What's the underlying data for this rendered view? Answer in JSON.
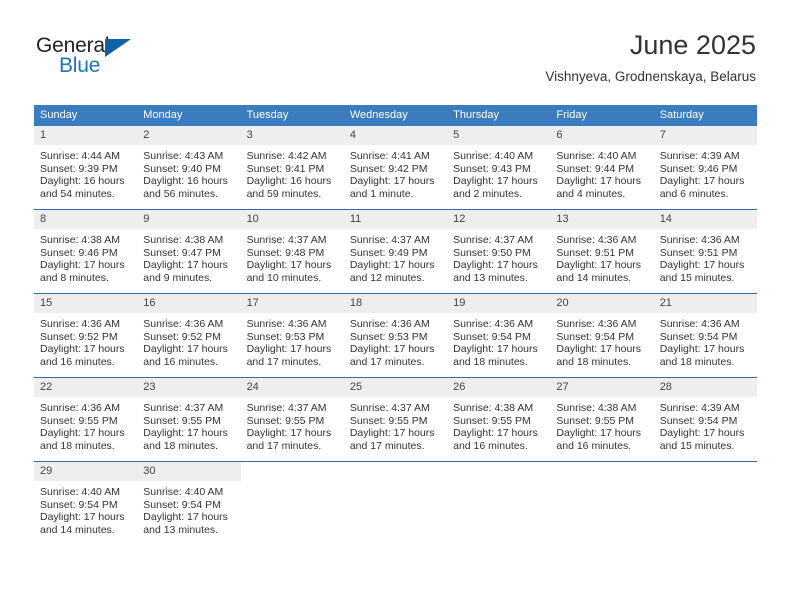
{
  "brand": {
    "name_top": "General",
    "name_bottom": "Blue",
    "triangle_color": "#1161a6",
    "blue_color": "#1b76bc"
  },
  "header": {
    "title": "June 2025",
    "subtitle": "Vishnyeva, Grodnenskaya, Belarus"
  },
  "theme": {
    "header_bg": "#3b7cbf",
    "row_divider": "#2e6da4",
    "daynum_bg": "#eeeeee"
  },
  "weekdays": [
    "Sunday",
    "Monday",
    "Tuesday",
    "Wednesday",
    "Thursday",
    "Friday",
    "Saturday"
  ],
  "labels": {
    "sunrise_prefix": "Sunrise:",
    "sunset_prefix": "Sunset:",
    "daylight_prefix": "Daylight:"
  },
  "weeks": [
    [
      {
        "day": "1",
        "sunrise": "Sunrise: 4:44 AM",
        "sunset": "Sunset: 9:39 PM",
        "daylight": "Daylight: 16 hours and 54 minutes."
      },
      {
        "day": "2",
        "sunrise": "Sunrise: 4:43 AM",
        "sunset": "Sunset: 9:40 PM",
        "daylight": "Daylight: 16 hours and 56 minutes."
      },
      {
        "day": "3",
        "sunrise": "Sunrise: 4:42 AM",
        "sunset": "Sunset: 9:41 PM",
        "daylight": "Daylight: 16 hours and 59 minutes."
      },
      {
        "day": "4",
        "sunrise": "Sunrise: 4:41 AM",
        "sunset": "Sunset: 9:42 PM",
        "daylight": "Daylight: 17 hours and 1 minute."
      },
      {
        "day": "5",
        "sunrise": "Sunrise: 4:40 AM",
        "sunset": "Sunset: 9:43 PM",
        "daylight": "Daylight: 17 hours and 2 minutes."
      },
      {
        "day": "6",
        "sunrise": "Sunrise: 4:40 AM",
        "sunset": "Sunset: 9:44 PM",
        "daylight": "Daylight: 17 hours and 4 minutes."
      },
      {
        "day": "7",
        "sunrise": "Sunrise: 4:39 AM",
        "sunset": "Sunset: 9:46 PM",
        "daylight": "Daylight: 17 hours and 6 minutes."
      }
    ],
    [
      {
        "day": "8",
        "sunrise": "Sunrise: 4:38 AM",
        "sunset": "Sunset: 9:46 PM",
        "daylight": "Daylight: 17 hours and 8 minutes."
      },
      {
        "day": "9",
        "sunrise": "Sunrise: 4:38 AM",
        "sunset": "Sunset: 9:47 PM",
        "daylight": "Daylight: 17 hours and 9 minutes."
      },
      {
        "day": "10",
        "sunrise": "Sunrise: 4:37 AM",
        "sunset": "Sunset: 9:48 PM",
        "daylight": "Daylight: 17 hours and 10 minutes."
      },
      {
        "day": "11",
        "sunrise": "Sunrise: 4:37 AM",
        "sunset": "Sunset: 9:49 PM",
        "daylight": "Daylight: 17 hours and 12 minutes."
      },
      {
        "day": "12",
        "sunrise": "Sunrise: 4:37 AM",
        "sunset": "Sunset: 9:50 PM",
        "daylight": "Daylight: 17 hours and 13 minutes."
      },
      {
        "day": "13",
        "sunrise": "Sunrise: 4:36 AM",
        "sunset": "Sunset: 9:51 PM",
        "daylight": "Daylight: 17 hours and 14 minutes."
      },
      {
        "day": "14",
        "sunrise": "Sunrise: 4:36 AM",
        "sunset": "Sunset: 9:51 PM",
        "daylight": "Daylight: 17 hours and 15 minutes."
      }
    ],
    [
      {
        "day": "15",
        "sunrise": "Sunrise: 4:36 AM",
        "sunset": "Sunset: 9:52 PM",
        "daylight": "Daylight: 17 hours and 16 minutes."
      },
      {
        "day": "16",
        "sunrise": "Sunrise: 4:36 AM",
        "sunset": "Sunset: 9:52 PM",
        "daylight": "Daylight: 17 hours and 16 minutes."
      },
      {
        "day": "17",
        "sunrise": "Sunrise: 4:36 AM",
        "sunset": "Sunset: 9:53 PM",
        "daylight": "Daylight: 17 hours and 17 minutes."
      },
      {
        "day": "18",
        "sunrise": "Sunrise: 4:36 AM",
        "sunset": "Sunset: 9:53 PM",
        "daylight": "Daylight: 17 hours and 17 minutes."
      },
      {
        "day": "19",
        "sunrise": "Sunrise: 4:36 AM",
        "sunset": "Sunset: 9:54 PM",
        "daylight": "Daylight: 17 hours and 18 minutes."
      },
      {
        "day": "20",
        "sunrise": "Sunrise: 4:36 AM",
        "sunset": "Sunset: 9:54 PM",
        "daylight": "Daylight: 17 hours and 18 minutes."
      },
      {
        "day": "21",
        "sunrise": "Sunrise: 4:36 AM",
        "sunset": "Sunset: 9:54 PM",
        "daylight": "Daylight: 17 hours and 18 minutes."
      }
    ],
    [
      {
        "day": "22",
        "sunrise": "Sunrise: 4:36 AM",
        "sunset": "Sunset: 9:55 PM",
        "daylight": "Daylight: 17 hours and 18 minutes."
      },
      {
        "day": "23",
        "sunrise": "Sunrise: 4:37 AM",
        "sunset": "Sunset: 9:55 PM",
        "daylight": "Daylight: 17 hours and 18 minutes."
      },
      {
        "day": "24",
        "sunrise": "Sunrise: 4:37 AM",
        "sunset": "Sunset: 9:55 PM",
        "daylight": "Daylight: 17 hours and 17 minutes."
      },
      {
        "day": "25",
        "sunrise": "Sunrise: 4:37 AM",
        "sunset": "Sunset: 9:55 PM",
        "daylight": "Daylight: 17 hours and 17 minutes."
      },
      {
        "day": "26",
        "sunrise": "Sunrise: 4:38 AM",
        "sunset": "Sunset: 9:55 PM",
        "daylight": "Daylight: 17 hours and 16 minutes."
      },
      {
        "day": "27",
        "sunrise": "Sunrise: 4:38 AM",
        "sunset": "Sunset: 9:55 PM",
        "daylight": "Daylight: 17 hours and 16 minutes."
      },
      {
        "day": "28",
        "sunrise": "Sunrise: 4:39 AM",
        "sunset": "Sunset: 9:54 PM",
        "daylight": "Daylight: 17 hours and 15 minutes."
      }
    ],
    [
      {
        "day": "29",
        "sunrise": "Sunrise: 4:40 AM",
        "sunset": "Sunset: 9:54 PM",
        "daylight": "Daylight: 17 hours and 14 minutes."
      },
      {
        "day": "30",
        "sunrise": "Sunrise: 4:40 AM",
        "sunset": "Sunset: 9:54 PM",
        "daylight": "Daylight: 17 hours and 13 minutes."
      },
      {
        "day": "",
        "sunrise": "",
        "sunset": "",
        "daylight": ""
      },
      {
        "day": "",
        "sunrise": "",
        "sunset": "",
        "daylight": ""
      },
      {
        "day": "",
        "sunrise": "",
        "sunset": "",
        "daylight": ""
      },
      {
        "day": "",
        "sunrise": "",
        "sunset": "",
        "daylight": ""
      },
      {
        "day": "",
        "sunrise": "",
        "sunset": "",
        "daylight": ""
      }
    ]
  ]
}
